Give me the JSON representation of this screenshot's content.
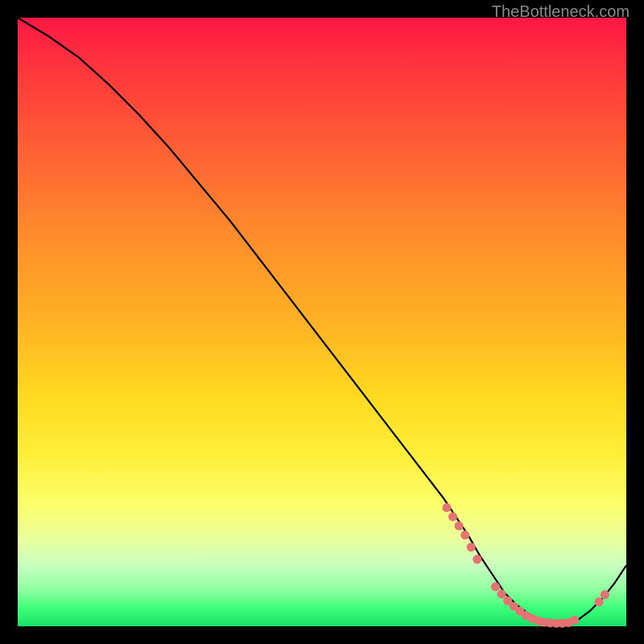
{
  "watermark": "TheBottleneck.com",
  "chart_data": {
    "type": "line",
    "title": "",
    "xlabel": "",
    "ylabel": "",
    "xlim": [
      0,
      100
    ],
    "ylim": [
      0,
      100
    ],
    "series": [
      {
        "name": "curve",
        "x": [
          0,
          5,
          10,
          15,
          20,
          25,
          30,
          35,
          40,
          45,
          50,
          55,
          60,
          65,
          70,
          72,
          74,
          76,
          78,
          80,
          82,
          84,
          86,
          88,
          90,
          92,
          94,
          96,
          98,
          100
        ],
        "y": [
          100,
          97,
          93.5,
          89,
          84,
          78.5,
          72.5,
          66.5,
          60,
          53.5,
          47,
          40.5,
          34,
          27.5,
          21,
          18,
          15,
          11.5,
          8.5,
          5.5,
          3.5,
          2,
          1,
          0.5,
          0.5,
          1,
          2.5,
          4.5,
          7,
          10
        ]
      }
    ],
    "markers": [
      {
        "x": 70.5,
        "y": 19.5
      },
      {
        "x": 71.5,
        "y": 18.0
      },
      {
        "x": 72.5,
        "y": 16.5
      },
      {
        "x": 73.5,
        "y": 15.0
      },
      {
        "x": 74.5,
        "y": 13.0
      },
      {
        "x": 75.5,
        "y": 11.0
      },
      {
        "x": 78.5,
        "y": 6.5
      },
      {
        "x": 79.5,
        "y": 5.3
      },
      {
        "x": 80.5,
        "y": 4.2
      },
      {
        "x": 81.5,
        "y": 3.3
      },
      {
        "x": 82.5,
        "y": 2.5
      },
      {
        "x": 83.5,
        "y": 1.8
      },
      {
        "x": 84.5,
        "y": 1.3
      },
      {
        "x": 85.5,
        "y": 0.9
      },
      {
        "x": 86.5,
        "y": 0.65
      },
      {
        "x": 87.5,
        "y": 0.55
      },
      {
        "x": 88.5,
        "y": 0.5
      },
      {
        "x": 89.5,
        "y": 0.5
      },
      {
        "x": 90.5,
        "y": 0.6
      },
      {
        "x": 91.5,
        "y": 1.0
      },
      {
        "x": 95.5,
        "y": 4.0
      },
      {
        "x": 96.5,
        "y": 5.2
      }
    ]
  }
}
